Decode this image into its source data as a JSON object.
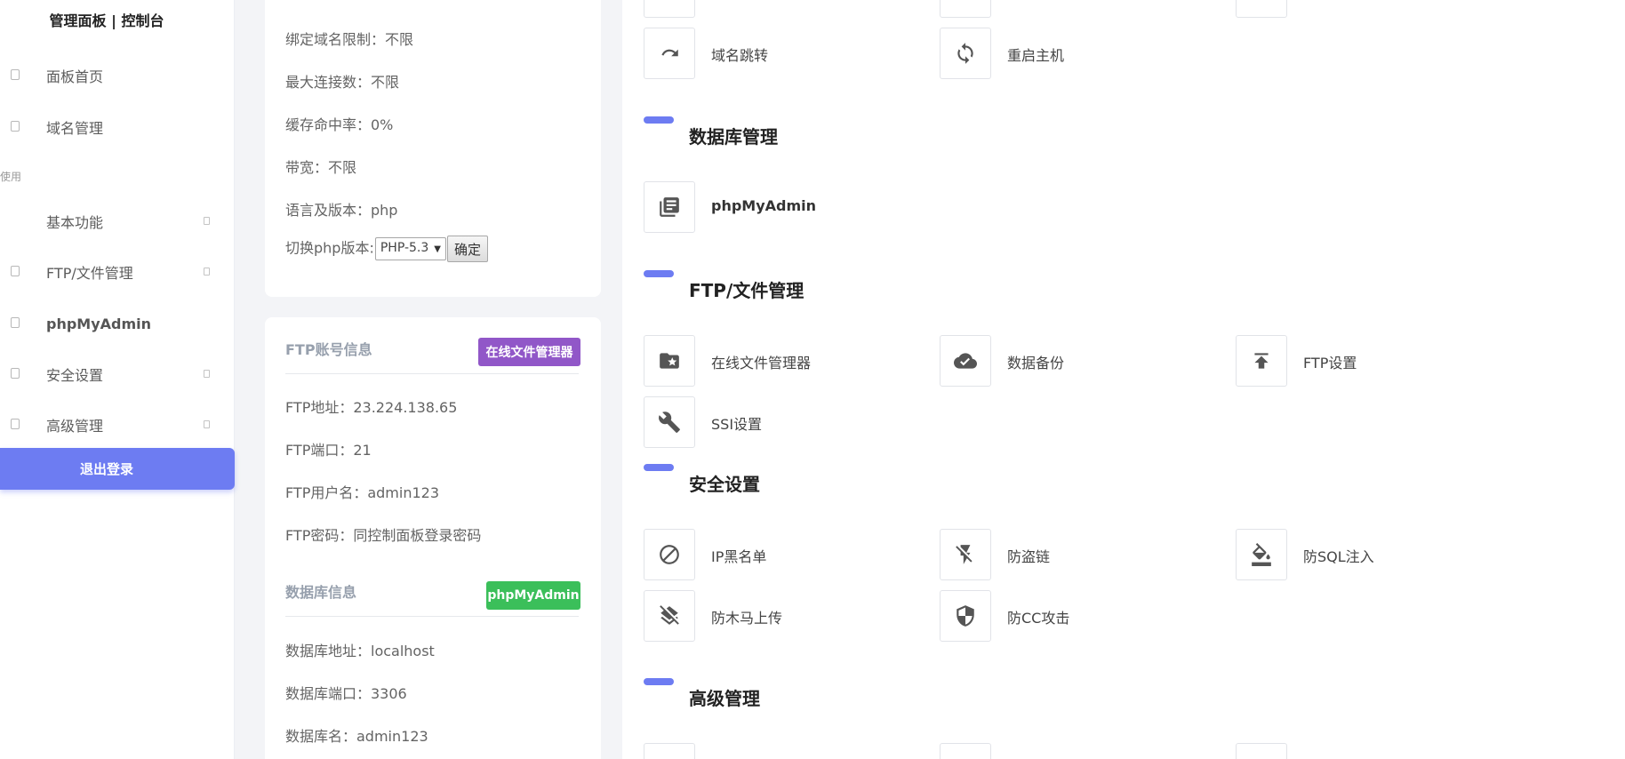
{
  "sidebar": {
    "brand": "管理面板 | 控制台",
    "section_label": "使用",
    "items": [
      {
        "label": "面板首页"
      },
      {
        "label": "域名管理"
      },
      {
        "label": "基本功能"
      },
      {
        "label": "FTP/文件管理"
      },
      {
        "label": "phpMyAdmin"
      },
      {
        "label": "安全设置"
      },
      {
        "label": "高级管理"
      }
    ],
    "logout": "退出登录"
  },
  "site_info": {
    "lines": [
      "绑定域名限制：不限",
      "最大连接数：不限",
      "缓存命中率：0%",
      "带宽：不限",
      "语言及版本：php"
    ],
    "php_switch_label": "切换php版本:",
    "php_version_selected": "PHP-5.3",
    "confirm_button": "确定"
  },
  "ftp_info": {
    "title": "FTP账号信息",
    "badge": "在线文件管理器",
    "lines": [
      "FTP地址：23.224.138.65",
      "FTP端口：21",
      "FTP用户名：admin123",
      "FTP密码：同控制面板登录密码"
    ]
  },
  "db_info": {
    "title": "数据库信息",
    "badge": "phpMyAdmin",
    "lines": [
      "数据库地址：localhost",
      "数据库端口：3306",
      "数据库名：admin123"
    ]
  },
  "panel": {
    "top_tiles": [
      {
        "label": "域名跳转",
        "icon": "redo-arrow-icon"
      },
      {
        "label": "重启主机",
        "icon": "sync-icon"
      }
    ],
    "sections": [
      {
        "title": "数据库管理",
        "tiles": [
          {
            "label": "phpMyAdmin",
            "icon": "library-books-icon"
          }
        ]
      },
      {
        "title": "FTP/文件管理",
        "tiles": [
          {
            "label": "在线文件管理器",
            "icon": "folder-star-icon"
          },
          {
            "label": "数据备份",
            "icon": "cloud-done-icon"
          },
          {
            "label": "FTP设置",
            "icon": "upload-icon"
          },
          {
            "label": "SSI设置",
            "icon": "wrench-icon"
          }
        ]
      },
      {
        "title": "安全设置",
        "tiles": [
          {
            "label": "IP黑名单",
            "icon": "block-icon"
          },
          {
            "label": "防盗链",
            "icon": "flash-off-icon"
          },
          {
            "label": "防SQL注入",
            "icon": "paint-bucket-icon"
          },
          {
            "label": "防木马上传",
            "icon": "layers-off-icon"
          },
          {
            "label": "防CC攻击",
            "icon": "shield-icon"
          }
        ]
      },
      {
        "title": "高级管理",
        "tiles": []
      }
    ]
  },
  "colors": {
    "accent": "#6d7cf2",
    "purple_badge": "#9157c8",
    "green_badge": "#3bbf5a"
  }
}
